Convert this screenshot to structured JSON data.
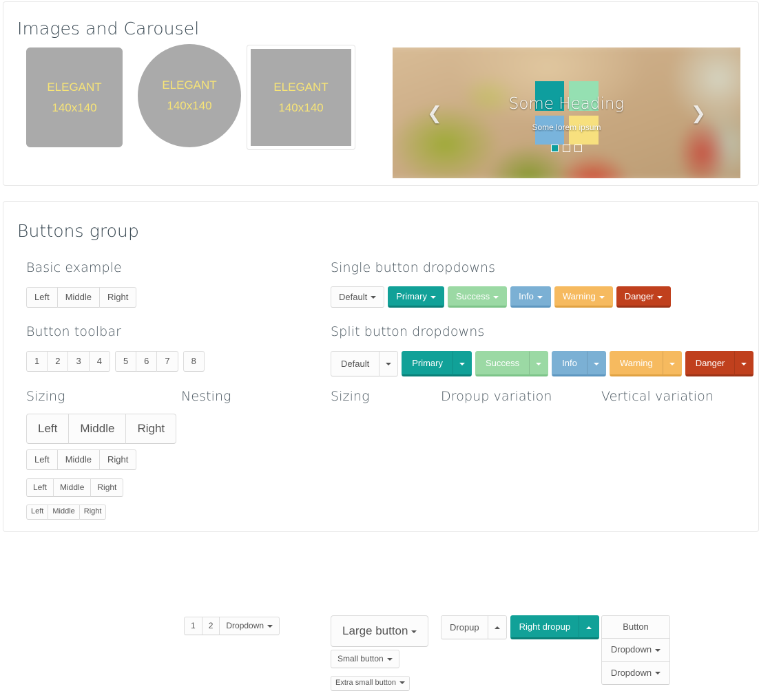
{
  "images_section": {
    "title": "Images and Carousel",
    "placeholders": [
      {
        "line1": "ELEGANT",
        "line2": "140x140",
        "shape": "rounded"
      },
      {
        "line1": "ELEGANT",
        "line2": "140x140",
        "shape": "circle"
      },
      {
        "line1": "ELEGANT",
        "line2": "140x140",
        "shape": "thumbnail"
      }
    ],
    "carousel": {
      "heading": "Some Heading",
      "subtext": "Some lorem ipsum",
      "prev_icon": "chevron-left-icon",
      "next_icon": "chevron-right-icon",
      "indicator_count": 3,
      "active_indicator": 0,
      "tile_colors": [
        "#0e9e9e",
        "#95e0b2",
        "#79b4dc",
        "#f7e07e"
      ]
    }
  },
  "buttons_section": {
    "title": "Buttons group",
    "basic_example": {
      "title": "Basic example",
      "buttons": [
        "Left",
        "Middle",
        "Right"
      ]
    },
    "button_toolbar": {
      "title": "Button toolbar",
      "groups": [
        [
          "1",
          "2",
          "3",
          "4"
        ],
        [
          "5",
          "6",
          "7"
        ],
        [
          "8"
        ]
      ]
    },
    "sizing_left": {
      "title": "Sizing",
      "rows": [
        {
          "size": "lg",
          "buttons": [
            "Left",
            "Middle",
            "Right"
          ]
        },
        {
          "size": "md",
          "buttons": [
            "Left",
            "Middle",
            "Right"
          ]
        },
        {
          "size": "sm",
          "buttons": [
            "Left",
            "Middle",
            "Right"
          ]
        },
        {
          "size": "xs",
          "buttons": [
            "Left",
            "Middle",
            "Right"
          ]
        }
      ]
    },
    "nesting": {
      "title": "Nesting",
      "buttons": [
        "1",
        "2"
      ],
      "dropdown_label": "Dropdown"
    },
    "single_dropdowns": {
      "title": "Single button dropdowns",
      "buttons": [
        {
          "label": "Default",
          "variant": "default"
        },
        {
          "label": "Primary",
          "variant": "primary"
        },
        {
          "label": "Success",
          "variant": "success"
        },
        {
          "label": "Info",
          "variant": "info"
        },
        {
          "label": "Warning",
          "variant": "warning"
        },
        {
          "label": "Danger",
          "variant": "danger"
        }
      ]
    },
    "split_dropdowns": {
      "title": "Split button dropdowns",
      "buttons": [
        {
          "label": "Default",
          "variant": "default"
        },
        {
          "label": "Primary",
          "variant": "primary"
        },
        {
          "label": "Success",
          "variant": "success"
        },
        {
          "label": "Info",
          "variant": "info"
        },
        {
          "label": "Warning",
          "variant": "warning"
        },
        {
          "label": "Danger",
          "variant": "danger"
        }
      ]
    },
    "sizing_right": {
      "title": "Sizing",
      "buttons": [
        {
          "label": "Large button",
          "size": "lg"
        },
        {
          "label": "Small button",
          "size": "sm"
        },
        {
          "label": "Extra small button",
          "size": "xs"
        }
      ]
    },
    "dropup_variation": {
      "title": "Dropup variation",
      "left_label": "Dropup",
      "right_label": "Right dropup"
    },
    "vertical_variation": {
      "title": "Vertical variation",
      "buttons": [
        "Button",
        "Dropdown",
        "Dropdown"
      ]
    }
  },
  "colors": {
    "primary": "#11a198",
    "success": "#9bd9a4",
    "info": "#7bb0d4",
    "warning": "#f6ba5f",
    "danger": "#c0401d",
    "placeholder_bg": "#aaaaaa",
    "placeholder_text": "#f7e477"
  }
}
